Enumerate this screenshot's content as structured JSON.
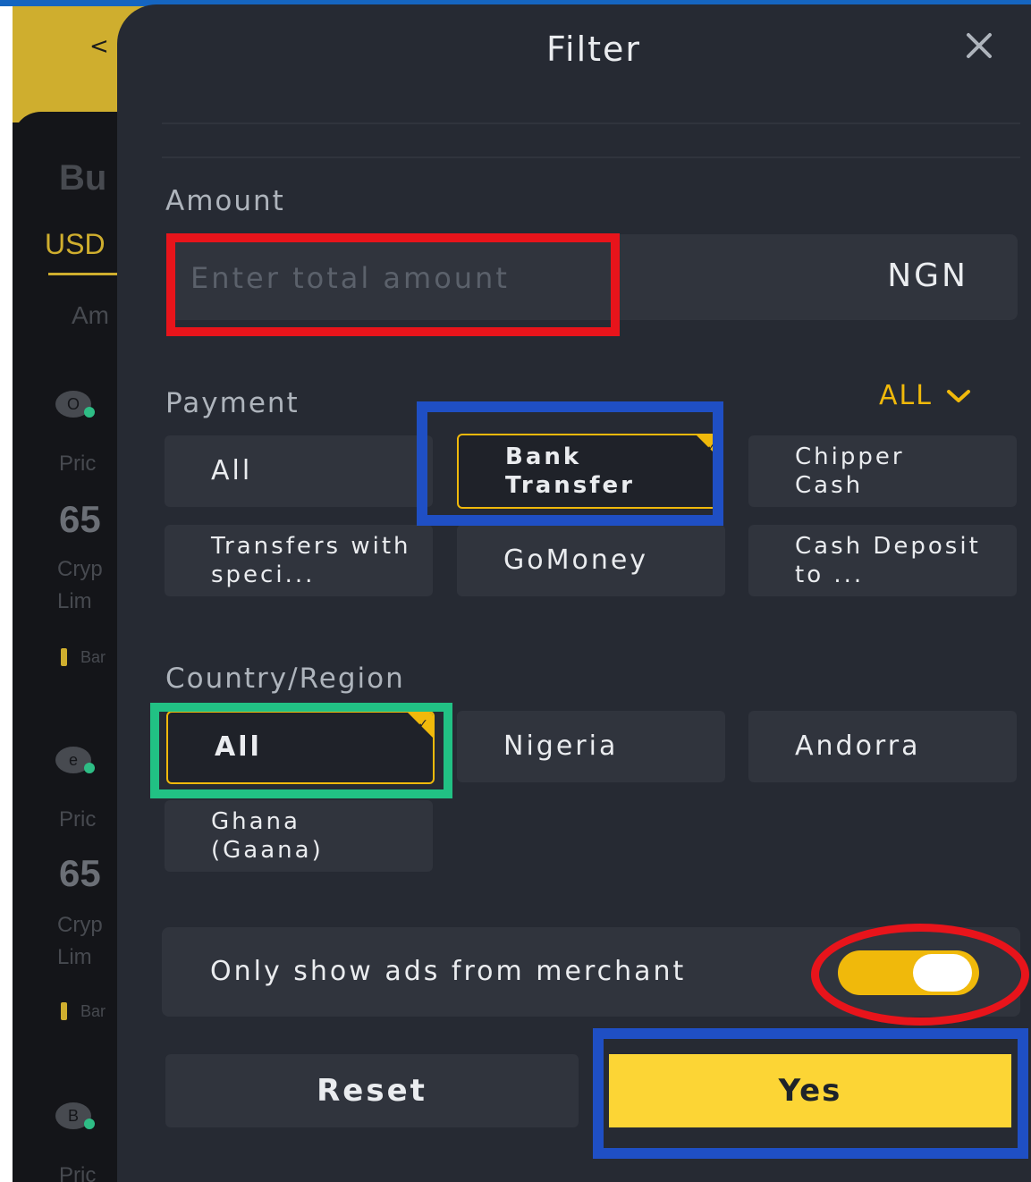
{
  "background": {
    "back": "<",
    "title": "Bu",
    "currency_tab": "USD",
    "column": "Am",
    "ads": [
      {
        "avatar": "O",
        "price_label": "Pric",
        "price": "65",
        "crypto": "Cryp",
        "limit": "Lim",
        "payment": "Bar"
      },
      {
        "avatar": "e",
        "price_label": "Pric",
        "price": "65",
        "crypto": "Cryp",
        "limit": "Lim",
        "payment": "Bar"
      },
      {
        "avatar": "B",
        "price_label": "Pric"
      }
    ]
  },
  "filter": {
    "title": "Filter",
    "close_icon": "close-icon",
    "amount": {
      "label": "Amount",
      "placeholder": "Enter total amount",
      "currency": "NGN"
    },
    "payment": {
      "label": "Payment",
      "dropdown_label": "ALL",
      "options": [
        {
          "label": "All",
          "selected": false
        },
        {
          "label": "Bank Transfer",
          "selected": true
        },
        {
          "label": "Chipper Cash",
          "selected": false
        },
        {
          "label": "Transfers with speci...",
          "selected": false
        },
        {
          "label": "GoMoney",
          "selected": false
        },
        {
          "label": "Cash Deposit to ...",
          "selected": false
        }
      ]
    },
    "country": {
      "label": "Country/Region",
      "options": [
        {
          "label": "All",
          "selected": true
        },
        {
          "label": "Nigeria",
          "selected": false
        },
        {
          "label": "Andorra",
          "selected": false
        },
        {
          "label": "Ghana (Gaana)",
          "selected": false
        }
      ]
    },
    "merchant_toggle": {
      "label": "Only show ads from merchant",
      "on": true
    },
    "buttons": {
      "reset": "Reset",
      "confirm": "Yes"
    }
  },
  "colors": {
    "accent": "#f0b90b",
    "confirm_button": "#fcd535",
    "panel": "#262a33",
    "annotation_red": "#e8141b",
    "annotation_blue": "#1f4fc4",
    "annotation_green": "#21c184"
  }
}
